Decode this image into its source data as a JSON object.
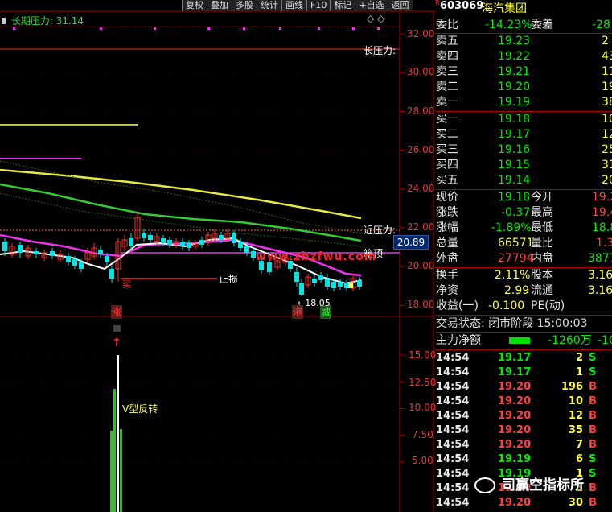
{
  "toolbar": [
    "复权",
    "叠加",
    "多股",
    "统计",
    "画线",
    "F10",
    "标记",
    "+自选",
    "返回"
  ],
  "stock": {
    "marker": "R",
    "code": "603069",
    "name": "海汽集团"
  },
  "indicator": {
    "title": "长期压力: 31.14",
    "diamonds": "◇ ◇"
  },
  "axis": {
    "price": [
      "32.00",
      "30.00",
      "28.00",
      "26.00",
      "24.00",
      "22.00",
      "20.00",
      "18.00"
    ],
    "current": "20.89",
    "lower": [
      "15.00",
      "12.50",
      "10.00",
      "7.50",
      "5.00"
    ]
  },
  "annotations": {
    "long_pressure": "长压力:",
    "near_pressure": "近压力:",
    "top": "箱顶",
    "stop": "止损",
    "buy": "买",
    "zhang": "涨",
    "gang": "港",
    "jian": "减",
    "low": "←18.05",
    "vrev": "V型反转",
    "arrow": "↑",
    "site": "www.zbzfwu.com"
  },
  "quote": {
    "weibi": {
      "label": "委比",
      "value": "-14.23%",
      "label2": "委差",
      "value2": "-28"
    },
    "sell": [
      {
        "label": "卖五",
        "price": "19.23",
        "vol": "2"
      },
      {
        "label": "卖四",
        "price": "19.22",
        "vol": "43"
      },
      {
        "label": "卖三",
        "price": "19.21",
        "vol": "11"
      },
      {
        "label": "卖二",
        "price": "19.20",
        "vol": "19"
      },
      {
        "label": "卖一",
        "price": "19.19",
        "vol": "38"
      }
    ],
    "buy": [
      {
        "label": "买一",
        "price": "19.18",
        "vol": "10"
      },
      {
        "label": "买二",
        "price": "19.17",
        "vol": "12"
      },
      {
        "label": "买三",
        "price": "19.16",
        "vol": "25"
      },
      {
        "label": "买四",
        "price": "19.15",
        "vol": "31"
      },
      {
        "label": "买五",
        "price": "19.14",
        "vol": "20"
      }
    ],
    "stats": [
      {
        "l1": "现价",
        "v1": "19.18",
        "l2": "今开",
        "v2": "19.2"
      },
      {
        "l1": "涨跌",
        "v1": "-0.37",
        "l2": "最高",
        "v2": "19.4"
      },
      {
        "l1": "涨幅",
        "v1": "-1.89%",
        "l2": "最低",
        "v2": "18.8"
      },
      {
        "l1": "总量",
        "v1": "66571",
        "l2": "量比",
        "v2": "1.3"
      },
      {
        "l1": "外盘",
        "v1": "27794",
        "l2": "内盘",
        "v2": "3877"
      }
    ],
    "stats2": [
      {
        "l1": "换手",
        "v1": "2.11%",
        "l2": "股本",
        "v2": "3.16"
      },
      {
        "l1": "净资",
        "v1": "2.99",
        "l2": "流通",
        "v2": "3.16"
      },
      {
        "l1": "收益(一)",
        "v1": "-0.100",
        "l2": "PE(动)",
        "v2": ""
      }
    ],
    "status": "交易状态: 闭市阶段 15:00:03",
    "netflow": {
      "label": "主力净额",
      "value": "-1260万",
      "value2": "-10"
    }
  },
  "ticks": [
    {
      "t": "14:54",
      "p": "19.17",
      "v": "2",
      "d": "S"
    },
    {
      "t": "14:54",
      "p": "19.17",
      "v": "1",
      "d": "S"
    },
    {
      "t": "14:54",
      "p": "19.20",
      "v": "196",
      "d": "B"
    },
    {
      "t": "14:54",
      "p": "19.20",
      "v": "10",
      "d": "B"
    },
    {
      "t": "14:54",
      "p": "19.20",
      "v": "12",
      "d": "B"
    },
    {
      "t": "14:54",
      "p": "19.20",
      "v": "35",
      "d": "B"
    },
    {
      "t": "14:54",
      "p": "19.20",
      "v": "7",
      "d": "B"
    },
    {
      "t": "14:54",
      "p": "19.19",
      "v": "6",
      "d": "S"
    },
    {
      "t": "14:54",
      "p": "19.19",
      "v": "1",
      "d": "S"
    },
    {
      "t": "14:54",
      "p": "19.20",
      "v": "5",
      "d": "B"
    },
    {
      "t": "14:54",
      "p": "19.20",
      "v": "30",
      "d": "B"
    }
  ],
  "watermark": "司赢空指标所",
  "colors": {
    "bg": "#000000",
    "up": "#ff3030",
    "down": "#00e5e5",
    "grid": "#aa0000",
    "ma_yellow": "#e8e840",
    "ma_green": "#33cc33",
    "ma_magenta": "#ee33ee",
    "ma_white": "#ffffff"
  }
}
